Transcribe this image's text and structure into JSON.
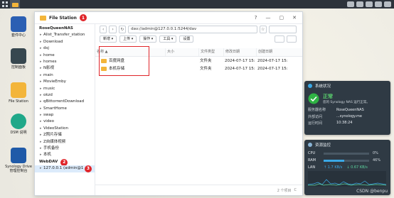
{
  "taskbar": {
    "icons": [
      "grid-icon",
      "file-station-icon"
    ]
  },
  "desktop": [
    {
      "name": "套件中心",
      "color": "#2b5fb3"
    },
    {
      "name": "控制面板",
      "color": "#37474f"
    },
    {
      "name": "File Station",
      "color": "#f3b53a"
    },
    {
      "name": "DSM 说明",
      "color": "#20a889"
    },
    {
      "name": "Synology Drive 管理控制台",
      "color": "#1f5aa8"
    }
  ],
  "window": {
    "title": "File Station",
    "badges": [
      "1",
      "2",
      "3"
    ],
    "controls": [
      "?",
      "—",
      "▢",
      "✕"
    ]
  },
  "sidebar": {
    "root1": "RoseQueenNAS",
    "items": [
      "Alist_Transfer_station",
      "Download",
      "dsj",
      "home",
      "homes",
      "N影视",
      "main",
      "MovieEmby",
      "music",
      "okzd",
      "qBittorrentDownload",
      "SmartHome",
      "swap",
      "video",
      "VideoStation",
      "Z照片存储",
      "Z自媒体视频",
      "手机备份",
      "本机"
    ],
    "root2": "WebDAV",
    "webdav_item": "127.0.0.1 (admin@127..."
  },
  "toolbar": {
    "path": "dav://admin@127.0.0.1:5244/dav",
    "actions": [
      "新增 ▾",
      "上传 ▾",
      "操作 ▾",
      "工具 ▾",
      "设置"
    ]
  },
  "table": {
    "headers": [
      "名称 ▲",
      "大小",
      "文件类型",
      "修改日期",
      "创建日期"
    ],
    "rows": [
      {
        "name": "百度网盘",
        "size": "",
        "type": "文件夹",
        "modified": "2024-07-17 15:3...",
        "created": "2024-07-17 15:3..."
      },
      {
        "name": "本机存储",
        "size": "",
        "type": "文件夹",
        "modified": "2024-07-17 15:3...",
        "created": "2024-07-17 15:3..."
      }
    ]
  },
  "statusbar": {
    "count": "2 个项目",
    "refresh": "C"
  },
  "health": {
    "title": "系统状况",
    "status": "正常",
    "status_desc": "您的 Synology NAS 运行正常。",
    "rows": [
      {
        "k": "服务器名称",
        "v": "RoseQueenNAS"
      },
      {
        "k": "外部访问",
        "v": "...synology.me"
      },
      {
        "k": "运行时间",
        "v": "10:38:24"
      }
    ]
  },
  "resource": {
    "title": "资源监控",
    "cpu_label": "CPU",
    "cpu_pct": 0.0,
    "ram_label": "RAM",
    "ram_pct": 0.46,
    "lan_label": "LAN",
    "up": "↑ 1.7 KB/s",
    "down": "↓ 0.67 KB/s"
  },
  "watermark": "CSDN @benpu"
}
